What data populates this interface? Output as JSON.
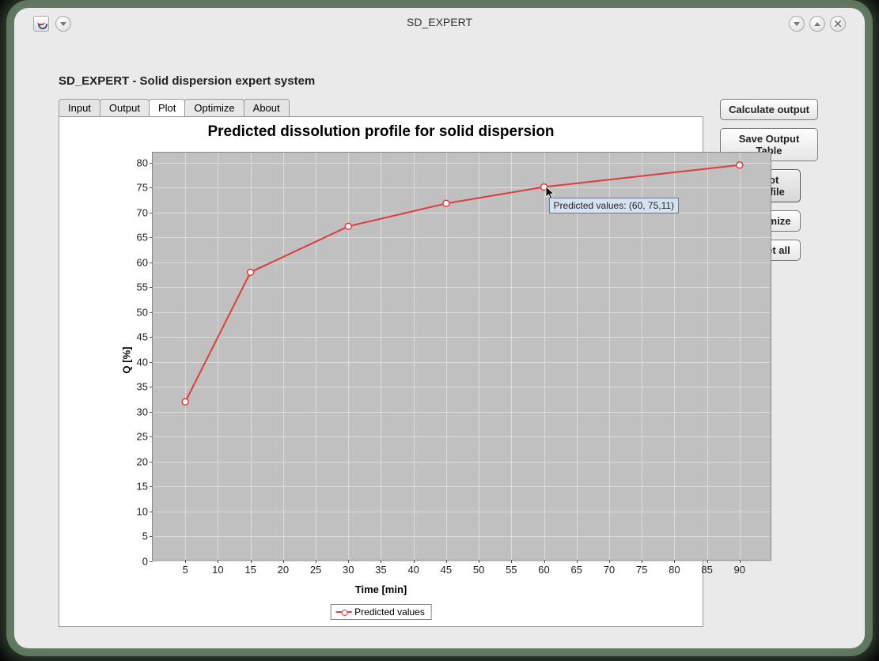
{
  "window": {
    "title": "SD_EXPERT"
  },
  "page": {
    "title": "SD_EXPERT - Solid dispersion expert system"
  },
  "tabs": {
    "items": [
      "Input",
      "Output",
      "Plot",
      "Optimize",
      "About"
    ],
    "active_index": 2
  },
  "side_buttons": {
    "calculate": "Calculate output",
    "save": "Save Output Table",
    "plot": "Plot profile",
    "optimize": "Optimize",
    "reset": "Reset all"
  },
  "chart_data": {
    "type": "line",
    "title": "Predicted dissolution profile for solid dispersion",
    "xlabel": "Time [min]",
    "ylabel": "Q [%]",
    "xlim": [
      0,
      95
    ],
    "ylim": [
      0,
      82
    ],
    "xticks": [
      5,
      10,
      15,
      20,
      25,
      30,
      35,
      40,
      45,
      50,
      55,
      60,
      65,
      70,
      75,
      80,
      85,
      90
    ],
    "yticks": [
      0,
      5,
      10,
      15,
      20,
      25,
      30,
      35,
      40,
      45,
      50,
      55,
      60,
      65,
      70,
      75,
      80
    ],
    "legend": "Predicted values",
    "series": [
      {
        "name": "Predicted values",
        "x": [
          5,
          15,
          30,
          45,
          60,
          90
        ],
        "y": [
          32,
          58,
          67.2,
          71.8,
          75.1,
          79.5
        ]
      }
    ],
    "tooltip": {
      "text": "Predicted values: (60, 75,11)",
      "at_x": 60,
      "at_y": 75.11
    }
  }
}
